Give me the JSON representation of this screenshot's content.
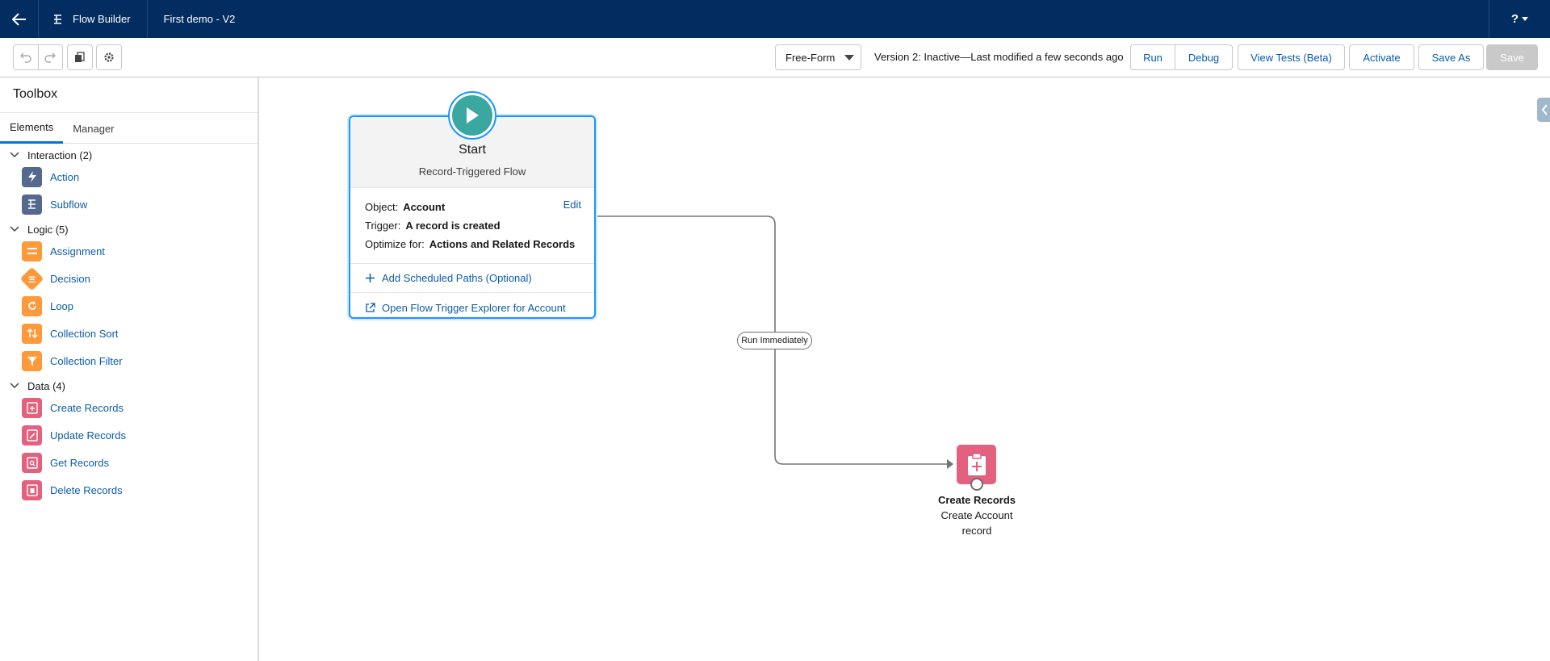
{
  "header": {
    "app_name": "Flow Builder",
    "flow_name": "First demo - V2",
    "help_label": "?"
  },
  "toolbar": {
    "mode": "Free-Form",
    "version_status": "Version 2: Inactive—Last modified a few seconds ago",
    "run": "Run",
    "debug": "Debug",
    "view_tests": "View Tests (Beta)",
    "activate": "Activate",
    "save_as": "Save As",
    "save": "Save"
  },
  "sidebar": {
    "title": "Toolbox",
    "tabs": [
      "Elements",
      "Manager"
    ],
    "sections": [
      {
        "label": "Interaction (2)",
        "items": [
          "Action",
          "Subflow"
        ]
      },
      {
        "label": "Logic (5)",
        "items": [
          "Assignment",
          "Decision",
          "Loop",
          "Collection Sort",
          "Collection Filter"
        ]
      },
      {
        "label": "Data (4)",
        "items": [
          "Create Records",
          "Update Records",
          "Get Records",
          "Delete Records"
        ]
      }
    ]
  },
  "start": {
    "title": "Start",
    "subtitle": "Record-Triggered Flow",
    "object_label": "Object:",
    "object_value": "Account",
    "edit": "Edit",
    "trigger_label": "Trigger:",
    "trigger_value": "A record is created",
    "optimize_label": "Optimize for:",
    "optimize_value": "Actions and Related Records",
    "add_paths": "Add Scheduled Paths (Optional)",
    "open_explorer": "Open Flow Trigger Explorer for Account"
  },
  "connector": {
    "label": "Run Immediately"
  },
  "node": {
    "type": "Create Records",
    "name_line1": "Create Account",
    "name_line2": "record"
  },
  "colors": {
    "header_bg": "#032d60",
    "brand_blue": "#0b5cab",
    "interaction": "#54698d",
    "logic": "#ff9a3c",
    "data": "#e3617f",
    "start": "#3aa8a0"
  }
}
